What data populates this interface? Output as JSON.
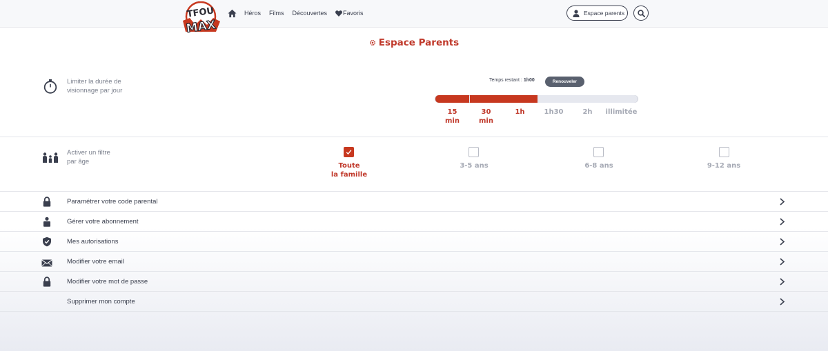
{
  "header": {
    "logo_text": "TFOU MAX",
    "nav": {
      "home_icon": "home-icon",
      "items": [
        "Héros",
        "Films",
        "Découvertes",
        "Favoris"
      ]
    },
    "espace_parents_button": "Espace parents",
    "search_icon": "search-icon"
  },
  "page": {
    "title": "Espace Parents",
    "title_icon": "gear-icon",
    "accent_color": "#c7381f"
  },
  "viewing_limit": {
    "label_line1": "Limiter la durée de",
    "label_line2": "visionnage par jour",
    "remaining_label": "Temps restant :",
    "remaining_value": "1h00",
    "renew_button": "Renouveler",
    "options": [
      {
        "line1": "15",
        "line2": "min",
        "selected": true
      },
      {
        "line1": "30",
        "line2": "min",
        "selected": true
      },
      {
        "line1": "1h",
        "line2": "",
        "selected": true
      },
      {
        "line1": "1h30",
        "line2": "",
        "selected": false
      },
      {
        "line1": "2h",
        "line2": "",
        "selected": false
      },
      {
        "line1": "illimitée",
        "line2": "",
        "selected": false
      }
    ]
  },
  "age_filter": {
    "label_line1": "Activer un filtre",
    "label_line2": "par âge",
    "options": [
      {
        "line1": "Toute",
        "line2": "la famille",
        "checked": true
      },
      {
        "line1": "3-5 ans",
        "line2": "",
        "checked": false
      },
      {
        "line1": "6-8 ans",
        "line2": "",
        "checked": false
      },
      {
        "line1": "9-12 ans",
        "line2": "",
        "checked": false
      }
    ]
  },
  "settings": [
    {
      "label": "Paramétrer votre code parental",
      "icon": "lock-icon"
    },
    {
      "label": "Gérer votre abonnement",
      "icon": "user-icon"
    },
    {
      "label": "Mes autorisations",
      "icon": "shield-check-icon"
    },
    {
      "label": "Modifier votre email",
      "icon": "envelope-icon"
    },
    {
      "label": "Modifier votre mot de passe",
      "icon": "lock-icon"
    },
    {
      "label": "Supprimer mon compte",
      "icon": ""
    }
  ]
}
